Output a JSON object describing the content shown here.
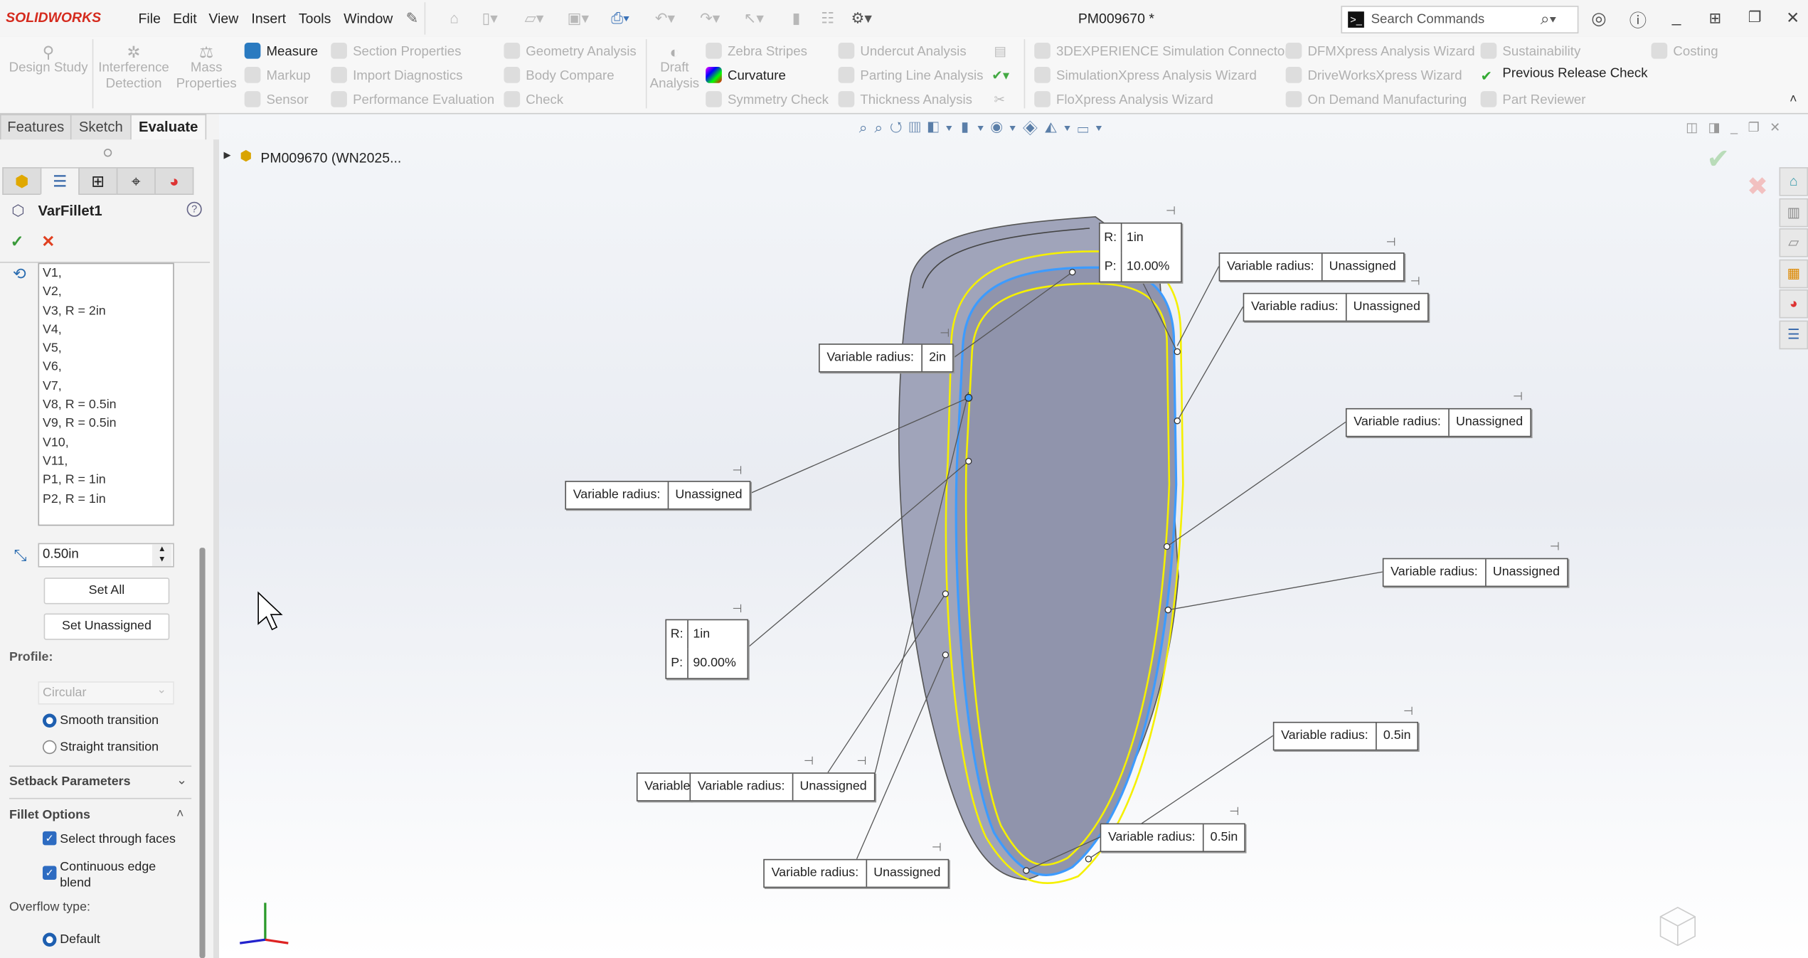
{
  "app": {
    "logo": "SOLIDWORKS",
    "document_title": "PM009670 *"
  },
  "menu": [
    "File",
    "Edit",
    "View",
    "Insert",
    "Tools",
    "Window"
  ],
  "search": {
    "placeholder": "Search Commands"
  },
  "command_manager": {
    "design_study": "Design Study",
    "interference": "Interference Detection",
    "mass": "Mass Properties",
    "measure": "Measure",
    "markup": "Markup",
    "sensor": "Sensor",
    "section": "Section Properties",
    "import_diag": "Import Diagnostics",
    "perf": "Performance Evaluation",
    "geometry": "Geometry Analysis",
    "body_compare": "Body Compare",
    "check": "Check",
    "draft": "Draft Analysis",
    "zebra": "Zebra Stripes",
    "curvature": "Curvature",
    "symmetry": "Symmetry Check",
    "undercut": "Undercut Analysis",
    "parting": "Parting Line Analysis",
    "thickness": "Thickness Analysis",
    "sim_connector": "3DEXPERIENCE Simulation Connector",
    "simxpress": "SimulationXpress Analysis Wizard",
    "floxpress": "FloXpress Analysis Wizard",
    "dfmxpress": "DFMXpress Analysis Wizard",
    "driveworks": "DriveWorksXpress Wizard",
    "on_demand": "On Demand Manufacturing",
    "sustainability": "Sustainability",
    "prev_release": "Previous Release Check",
    "part_reviewer": "Part Reviewer",
    "costing": "Costing"
  },
  "tabs": [
    "Features",
    "Sketch",
    "Evaluate"
  ],
  "active_tab": "Evaluate",
  "property_manager": {
    "title": "VarFillet1",
    "vertices": [
      "V1,",
      "V2,",
      "V3, R = 2in",
      "V4,",
      "V5,",
      "V6,",
      "V7,",
      "V8, R = 0.5in",
      "V9, R = 0.5in",
      "V10,",
      "V11,",
      "P1, R = 1in",
      "P2, R = 1in"
    ],
    "radius_value": "0.50in",
    "set_all": "Set All",
    "set_unassigned": "Set Unassigned",
    "profile_label": "Profile:",
    "profile_value": "Circular",
    "smooth": "Smooth transition",
    "straight": "Straight transition",
    "setback": "Setback Parameters",
    "fillet_options": "Fillet Options",
    "select_through": "Select through faces",
    "continuous": "Continuous edge blend",
    "overflow_label": "Overflow type:",
    "overflow_default": "Default"
  },
  "tree": {
    "root": "PM009670 (WN2025..."
  },
  "callouts": {
    "label": "Variable radius:",
    "partial": "Variable",
    "values": [
      "Unassigned",
      "Unassigned",
      "2in",
      "Unassigned",
      "Unassigned",
      "Unassigned",
      "Unassigned",
      "0.5in",
      "0.5in",
      "Unassigned"
    ],
    "rp1": {
      "r": "1in",
      "p": "10.00%"
    },
    "rp2": {
      "r": "1in",
      "p": "90.00%"
    },
    "r_key": "R:",
    "p_key": "P:"
  },
  "colors": {
    "accent": "#2d6bc1",
    "fillet_preview": "#f5f000",
    "edge": "#3d9bff",
    "model": "#9296ad",
    "logo": "#d52b1e"
  }
}
